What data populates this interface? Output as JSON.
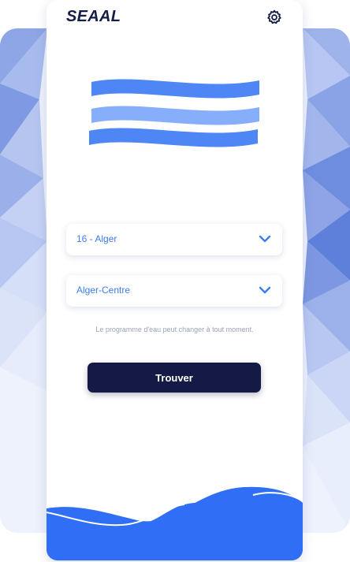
{
  "app": {
    "brand": "SEAAL"
  },
  "header": {
    "settings_icon": "gear-icon"
  },
  "logo": {
    "icon": "water-waves-logo",
    "colors": [
      "#4e86f5",
      "#86aefa",
      "#4e86f5"
    ]
  },
  "form": {
    "wilaya_value": "16 - Alger",
    "commune_value": "Alger-Centre",
    "note": "Le programme d'eau peut changer à tout moment.",
    "submit_label": "Trouver"
  },
  "colors": {
    "brand": "#141c47",
    "accent": "#3d7cf0",
    "button": "#141a45",
    "wave": "#2f6ef5"
  }
}
